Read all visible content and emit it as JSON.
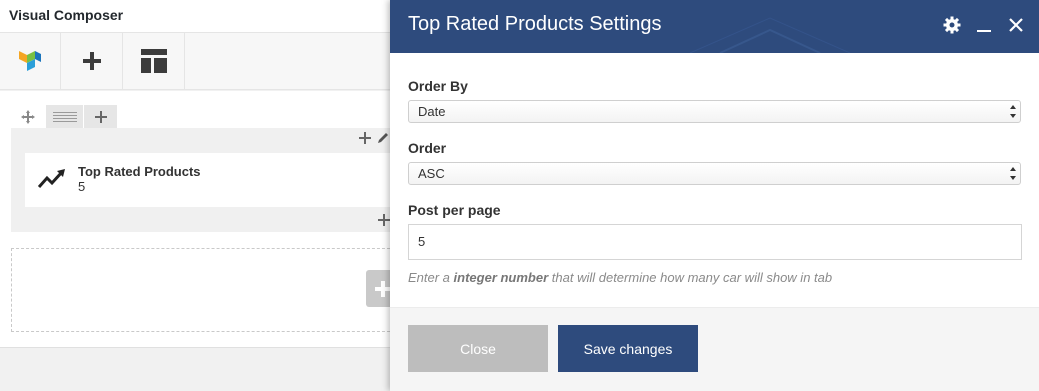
{
  "app": {
    "title": "Visual Composer"
  },
  "toolbar": {
    "items": [
      {
        "icon": "vc-logo-icon"
      },
      {
        "icon": "plus-icon"
      },
      {
        "icon": "templates-icon"
      }
    ]
  },
  "editor": {
    "element": {
      "name": "Top Rated Products",
      "value": "5",
      "icon": "trending-chart-icon"
    }
  },
  "modal": {
    "title": "Top Rated Products Settings",
    "header_icons": [
      "gear-icon",
      "minimize-icon",
      "close-icon"
    ],
    "fields": {
      "order_by": {
        "label": "Order By",
        "value": "Date"
      },
      "order": {
        "label": "Order",
        "value": "ASC"
      },
      "post_per_page": {
        "label": "Post per page",
        "value": "5",
        "help_prefix": "Enter a ",
        "help_bold": "integer number",
        "help_suffix": " that will determine how many car will show in tab"
      }
    },
    "buttons": {
      "close": "Close",
      "save": "Save changes"
    }
  },
  "colors": {
    "header_bg": "#2e4b7d",
    "save_button": "#2e4b7d",
    "close_button": "#bdbdbd"
  }
}
